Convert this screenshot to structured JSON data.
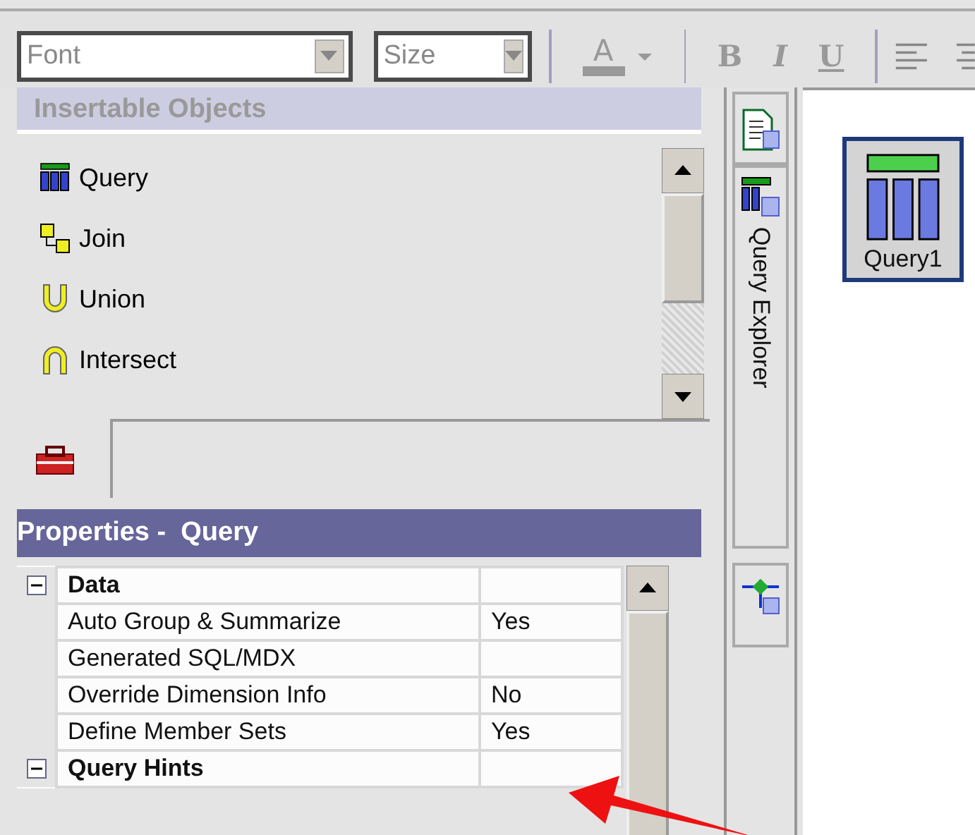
{
  "toolbar": {
    "font_field": {
      "placeholder": "Font"
    },
    "size_field": {
      "placeholder": "Size"
    },
    "buttons": [
      {
        "kind": "color",
        "label": "A"
      },
      {
        "kind": "bold",
        "label": "B"
      },
      {
        "kind": "italic",
        "label": "I"
      },
      {
        "kind": "underline",
        "label": "U"
      }
    ]
  },
  "insertable_objects": {
    "title": "Insertable Objects",
    "items": [
      {
        "kind": "query",
        "label": "Query"
      },
      {
        "kind": "join",
        "label": "Join"
      },
      {
        "kind": "union",
        "label": "Union"
      },
      {
        "kind": "intersect",
        "label": "Intersect"
      }
    ]
  },
  "properties": {
    "title": "Properties -  Query",
    "groups": [
      {
        "name": "Data",
        "expanded": true,
        "rows": [
          {
            "name": "Auto Group & Summarize",
            "value": "Yes"
          },
          {
            "name": "Generated SQL/MDX"
          },
          {
            "name": "Override Dimension Info",
            "value": "No"
          },
          {
            "name": "Define Member Sets",
            "value": "Yes"
          }
        ]
      },
      {
        "name": "Query Hints",
        "expanded": true
      }
    ]
  },
  "side_tabs": {
    "label": "Query Explorer"
  },
  "canvas": {
    "nodes": [
      {
        "label": "Query1",
        "selected": true
      }
    ]
  }
}
